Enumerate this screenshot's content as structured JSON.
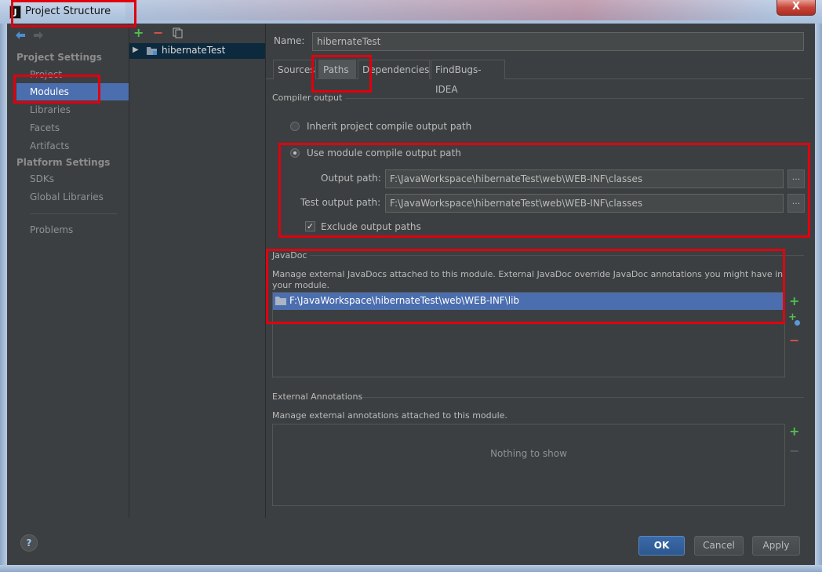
{
  "window": {
    "title": "Project Structure",
    "close_glyph": "X"
  },
  "nav": {
    "back_icon": "back-arrow-icon",
    "forward_icon": "forward-arrow-icon"
  },
  "sidebar": {
    "project_settings_header": "Project Settings",
    "items_project": [
      "Project",
      "Modules",
      "Libraries",
      "Facets",
      "Artifacts"
    ],
    "platform_settings_header": "Platform Settings",
    "items_platform": [
      "SDKs",
      "Global Libraries"
    ],
    "problems": "Problems",
    "selected": "Modules"
  },
  "module_toolbar": {
    "add": "+",
    "remove": "−",
    "copy_icon": "copy-icon"
  },
  "modules": {
    "items": [
      "hibernateTest"
    ]
  },
  "name": {
    "label": "Name:",
    "value": "hibernateTest"
  },
  "tabs": [
    "Sources",
    "Paths",
    "Dependencies",
    "FindBugs-IDEA"
  ],
  "selected_tab": "Paths",
  "compiler_output": {
    "title": "Compiler output",
    "inherit_label": "Inherit project compile output path",
    "use_module_label": "Use module compile output path",
    "selected_option": "use_module",
    "output_path_label": "Output path:",
    "output_path_value": "F:\\JavaWorkspace\\hibernateTest\\web\\WEB-INF\\classes",
    "test_output_path_label": "Test output path:",
    "test_output_path_value": "F:\\JavaWorkspace\\hibernateTest\\web\\WEB-INF\\classes",
    "browse": "...",
    "exclude_label": "Exclude output paths",
    "exclude_checked": true
  },
  "javadoc": {
    "title": "JavaDoc",
    "description": "Manage external JavaDocs attached to this module. External JavaDoc override JavaDoc annotations you might have in your module.",
    "items": [
      "F:\\JavaWorkspace\\hibernateTest\\web\\WEB-INF\\lib"
    ]
  },
  "external_annotations": {
    "title": "External Annotations",
    "description": "Manage external annotations attached to this module.",
    "empty_text": "Nothing to show"
  },
  "footer": {
    "help": "?",
    "ok": "OK",
    "cancel": "Cancel",
    "apply": "Apply"
  },
  "colors": {
    "accent": "#4b6eaf",
    "highlight_border": "#e0000e",
    "background": "#3c3f41"
  }
}
